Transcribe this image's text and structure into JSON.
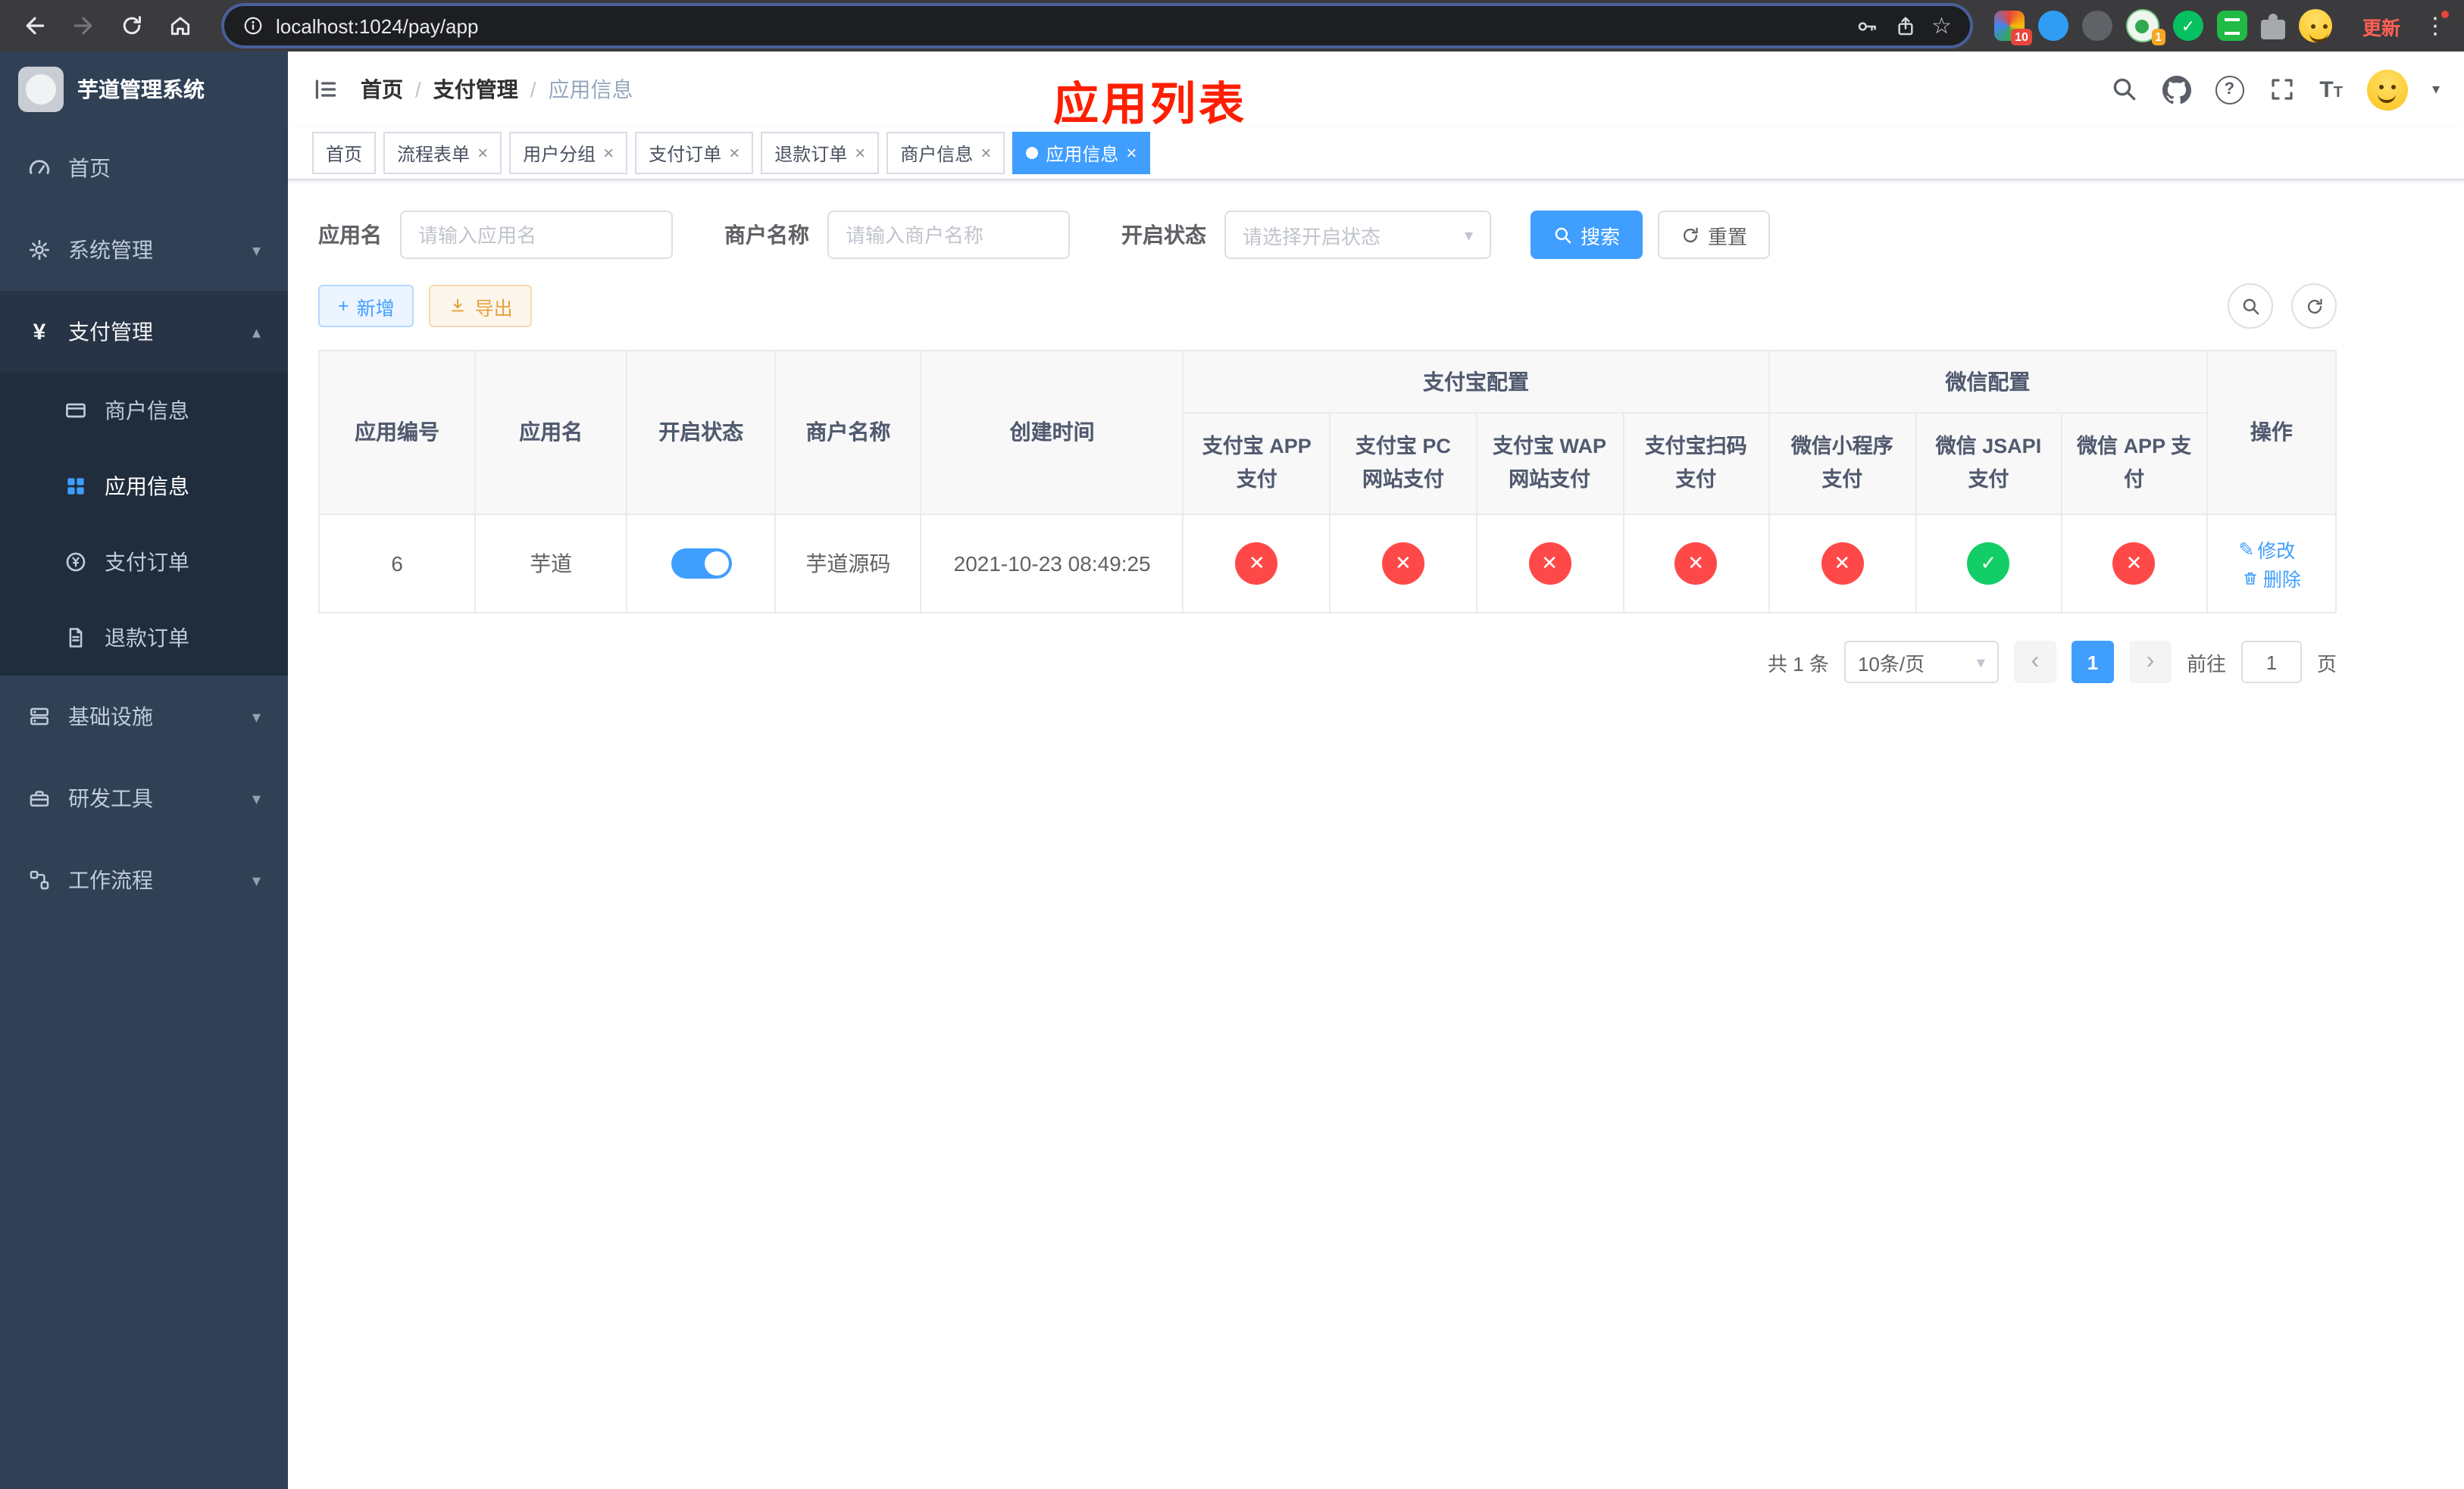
{
  "colors": {
    "primary": "#409eff",
    "success": "#13ce66",
    "danger": "#ff4949",
    "warning": "#e6a23c",
    "sidebar": "#304156",
    "submenu": "#1f2d3d",
    "overlay_red": "#ff1e00"
  },
  "glyphs": {
    "close": "×",
    "caret_down": "▾",
    "caret_up": "▴",
    "prev": "‹",
    "next": "›",
    "check": "✓",
    "cross": "✕",
    "edit": "✎",
    "plus": "+",
    "kebab": "⋮",
    "star": "☆",
    "question": "?",
    "font_large": "T",
    "font_small": "T"
  },
  "browser": {
    "url": "localhost:1024/pay/app",
    "update_label": "更新",
    "extension_badge": "10",
    "extension_badge2": "1"
  },
  "sidebar": {
    "title": "芋道管理系统",
    "items": [
      {
        "label": "首页"
      },
      {
        "label": "系统管理"
      },
      {
        "label": "支付管理"
      },
      {
        "label": "基础设施"
      },
      {
        "label": "研发工具"
      },
      {
        "label": "工作流程"
      }
    ],
    "children": [
      {
        "label": "商户信息"
      },
      {
        "label": "应用信息"
      },
      {
        "label": "支付订单"
      },
      {
        "label": "退款订单"
      }
    ]
  },
  "header": {
    "breadcrumb": {
      "home": "首页",
      "section": "支付管理",
      "current": "应用信息",
      "sep": "/"
    },
    "overlay_title": "应用列表"
  },
  "tags": [
    {
      "label": "首页"
    },
    {
      "label": "流程表单"
    },
    {
      "label": "用户分组"
    },
    {
      "label": "支付订单"
    },
    {
      "label": "退款订单"
    },
    {
      "label": "商户信息"
    },
    {
      "label": "应用信息"
    }
  ],
  "filters": {
    "app_name_label": "应用名",
    "app_name_placeholder": "请输入应用名",
    "merchant_label": "商户名称",
    "merchant_placeholder": "请输入商户名称",
    "status_label": "开启状态",
    "status_placeholder": "请选择开启状态",
    "search_label": "搜索",
    "reset_label": "重置"
  },
  "actions": {
    "add": "新增",
    "export": "导出"
  },
  "table": {
    "group_headers": {
      "alipay": "支付宝配置",
      "wechat": "微信配置"
    },
    "columns": {
      "id": "应用编号",
      "name": "应用名",
      "status": "开启状态",
      "merchant": "商户名称",
      "created": "创建时间",
      "alipay_app": "支付宝 APP 支付",
      "alipay_pc": "支付宝 PC 网站支付",
      "alipay_wap": "支付宝 WAP 网站支付",
      "alipay_qr": "支付宝扫码支付",
      "wx_mini": "微信小程序支付",
      "wx_jsapi": "微信 JSAPI 支付",
      "wx_app": "微信 APP 支付",
      "ops": "操作"
    },
    "rows": [
      {
        "id": "6",
        "name": "芋道",
        "enabled": true,
        "merchant": "芋道源码",
        "created": "2021-10-23 08:49:25",
        "alipay_app": false,
        "alipay_pc": false,
        "alipay_wap": false,
        "alipay_qr": false,
        "wx_mini": false,
        "wx_jsapi": true,
        "wx_app": false
      }
    ],
    "ops": {
      "edit": "修改",
      "delete": "删除"
    }
  },
  "pagination": {
    "total": "共 1 条",
    "page_size": "10条/页",
    "page": "1",
    "goto": "前往",
    "goto_value": "1",
    "unit": "页"
  }
}
